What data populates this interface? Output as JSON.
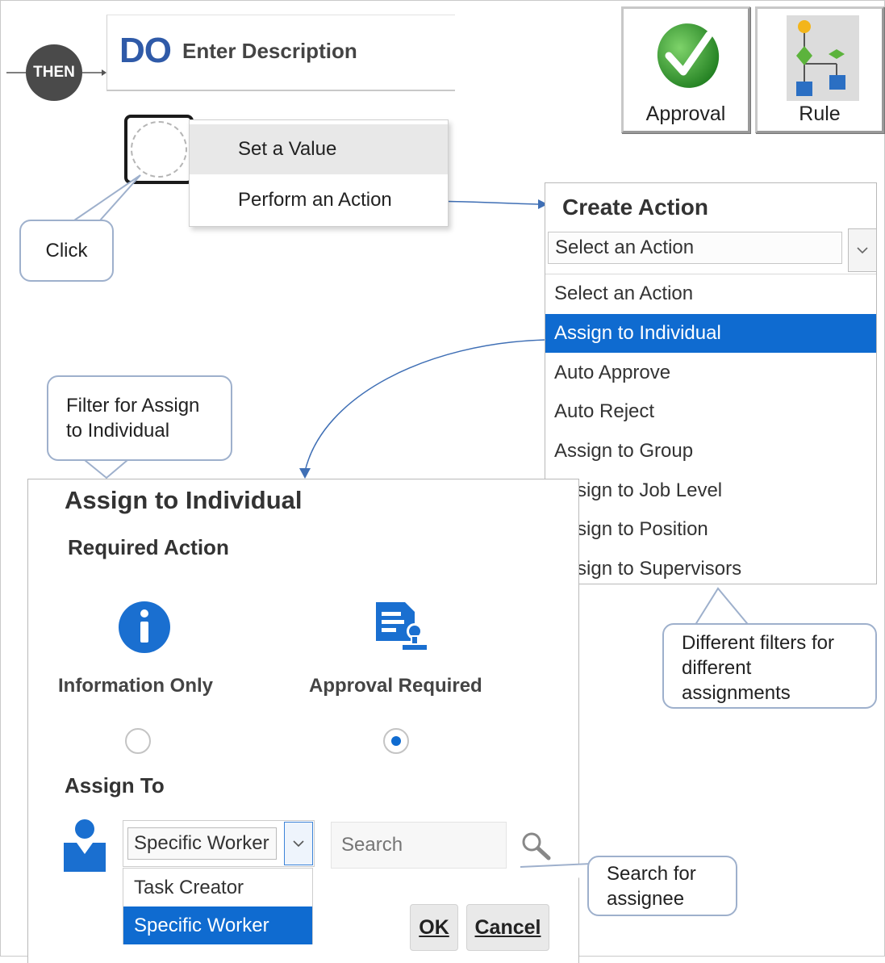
{
  "rule_header": {
    "then_label": "THEN",
    "do_label": "DO",
    "description": "Enter Description"
  },
  "context_menu": {
    "items": [
      "Set a Value",
      "Perform an Action"
    ]
  },
  "callouts": {
    "click": "Click",
    "filter_line1": "Filter for Assign",
    "filter_line2": "to Individual",
    "filters_line1": "Different  filters for",
    "filters_line2": "different",
    "filters_line3": "assignments",
    "search_line1": "Search for",
    "search_line2": "assignee"
  },
  "toolbar_buttons": {
    "approval": "Approval",
    "rule": "Rule"
  },
  "create_action": {
    "title": "Create Action",
    "selected_value": "Select an Action",
    "options": [
      "Select an Action",
      "Assign to Individual",
      "Auto Approve",
      "Auto Reject",
      "Assign to Group",
      "Assign to Job Level",
      "Assign to Position",
      "Assign to Supervisors"
    ],
    "highlighted": "Assign to Individual"
  },
  "assign_panel": {
    "title": "Assign to Individual",
    "required_action_label": "Required Action",
    "option_info": "Information Only",
    "option_approval": "Approval Required",
    "selected_option": "Approval Required",
    "assign_to_label": "Assign To",
    "worker_select_value": "Specific Worker",
    "worker_options": [
      "Task Creator",
      "Specific Worker"
    ],
    "search_placeholder": "Search",
    "ok_label": "OK",
    "cancel_label": "Cancel"
  },
  "colors": {
    "accent_blue": "#0f6bd0",
    "do_blue": "#2f5aa8",
    "approval_green": "#2e9e2e"
  },
  "icons": [
    "search-icon",
    "info-icon",
    "approval-document-icon",
    "person-icon",
    "checkmark-icon",
    "rule-tree-icon",
    "chevron-down-icon"
  ]
}
